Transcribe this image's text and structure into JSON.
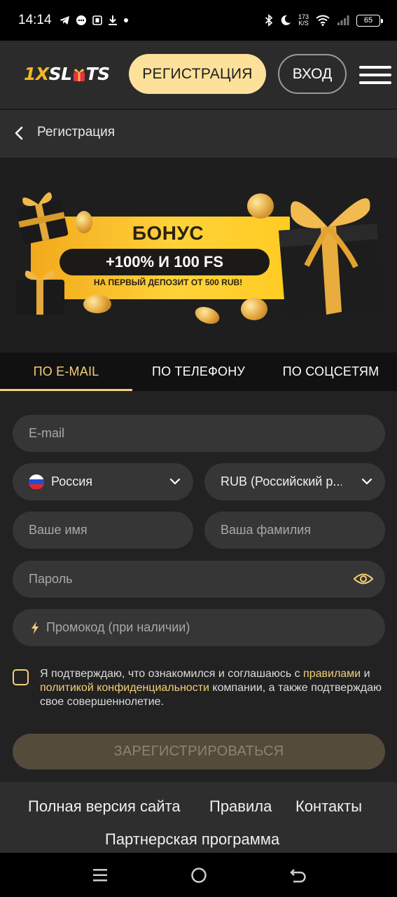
{
  "status_bar": {
    "time": "14:14",
    "net_speed_value": "173",
    "net_speed_unit": "K/S",
    "battery": "65"
  },
  "header": {
    "logo_part1": "1X",
    "logo_part2": "SL",
    "logo_part3": "TS",
    "register_label": "РЕГИСТРАЦИЯ",
    "login_label": "ВХОД"
  },
  "breadcrumb": {
    "title": "Регистрация"
  },
  "banner": {
    "title": "БОНУС",
    "offer": "+100% И 100 FS",
    "subtitle": "НА ПЕРВЫЙ ДЕПОЗИТ ОТ 500 RUB!"
  },
  "tabs": [
    {
      "label": "ПО E-MAIL",
      "active": true
    },
    {
      "label": "ПО ТЕЛЕФОНУ",
      "active": false
    },
    {
      "label": "ПО СОЦСЕТЯМ",
      "active": false
    }
  ],
  "form": {
    "email_placeholder": "E-mail",
    "country_value": "Россия",
    "currency_value": "RUB (Российский р...",
    "first_name_placeholder": "Ваше имя",
    "last_name_placeholder": "Ваша фамилия",
    "password_placeholder": "Пароль",
    "promo_placeholder": "Промокод (при наличии)",
    "agree_part1": "Я подтверждаю, что ознакомился и соглашаюсь с ",
    "agree_link_rules": "правилами",
    "agree_part2": " и ",
    "agree_link_privacy": "политикой конфиденциальности",
    "agree_part3": " компании, а также подтверждаю свое совершеннолетие.",
    "submit_label": "ЗАРЕГИСТРИРОВАТЬСЯ"
  },
  "footer": {
    "full_site": "Полная версия сайта",
    "rules": "Правила",
    "contacts": "Контакты",
    "partners": "Партнерская программа"
  },
  "colors": {
    "accent": "#f5cf77",
    "register_button": "#fde19a",
    "field_bg": "#363636"
  }
}
